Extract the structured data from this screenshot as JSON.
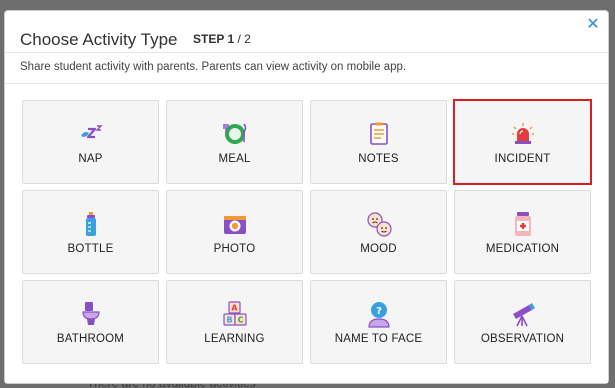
{
  "backdrop": {
    "text": "There are no available activities"
  },
  "modal": {
    "title": "Choose Activity Type",
    "step_prefix": "STEP 1",
    "step_suffix": " / 2",
    "close_label": "✕",
    "subtitle": "Share student activity with parents. Parents can view activity on mobile app."
  },
  "tiles": [
    {
      "label": "NAP",
      "icon": "sleep-icon"
    },
    {
      "label": "MEAL",
      "icon": "meal-icon"
    },
    {
      "label": "NOTES",
      "icon": "notes-icon"
    },
    {
      "label": "INCIDENT",
      "icon": "siren-icon"
    },
    {
      "label": "BOTTLE",
      "icon": "bottle-icon"
    },
    {
      "label": "PHOTO",
      "icon": "camera-icon"
    },
    {
      "label": "MOOD",
      "icon": "mood-faces-icon"
    },
    {
      "label": "MEDICATION",
      "icon": "medicine-jar-icon"
    },
    {
      "label": "BATHROOM",
      "icon": "toilet-icon"
    },
    {
      "label": "LEARNING",
      "icon": "abc-blocks-icon"
    },
    {
      "label": "NAME TO FACE",
      "icon": "person-question-icon"
    },
    {
      "label": "OBSERVATION",
      "icon": "telescope-icon"
    }
  ],
  "selected_tile": "INCIDENT",
  "colors": {
    "accent": "#2c8fd6",
    "selection": "#d81e1e",
    "icon_purple": "#8a4fc7",
    "icon_green": "#2fa84f",
    "icon_orange": "#f29a2e",
    "icon_red": "#e23c3c",
    "icon_blue": "#3aa0e0"
  }
}
